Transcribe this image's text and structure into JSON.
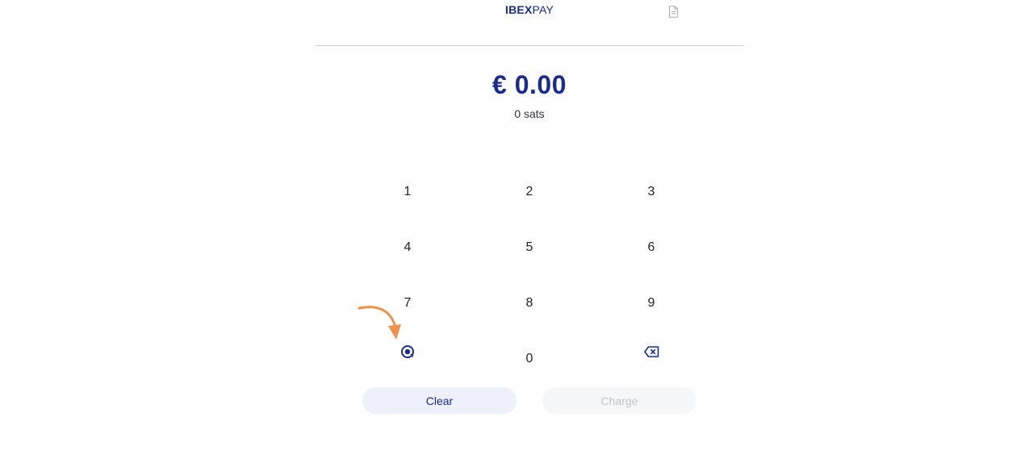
{
  "header": {
    "logo_bold": "IBEX",
    "logo_light": "PAY",
    "doc_icon": "document-icon"
  },
  "display": {
    "amount": "€ 0.00",
    "sats": "0 sats"
  },
  "keypad": {
    "k1": "1",
    "k2": "2",
    "k3": "3",
    "k4": "4",
    "k5": "5",
    "k6": "6",
    "k7": "7",
    "k8": "8",
    "k9": "9",
    "k0": "0",
    "left_icon": "lightning-scan-icon",
    "right_icon": "backspace-icon"
  },
  "actions": {
    "clear_label": "Clear",
    "charge_label": "Charge"
  },
  "colors": {
    "brand": "#1b2b8f",
    "annotation_arrow": "#f0914a",
    "clear_bg": "#eef0fb",
    "charge_disabled_bg": "#f6f7f9"
  }
}
